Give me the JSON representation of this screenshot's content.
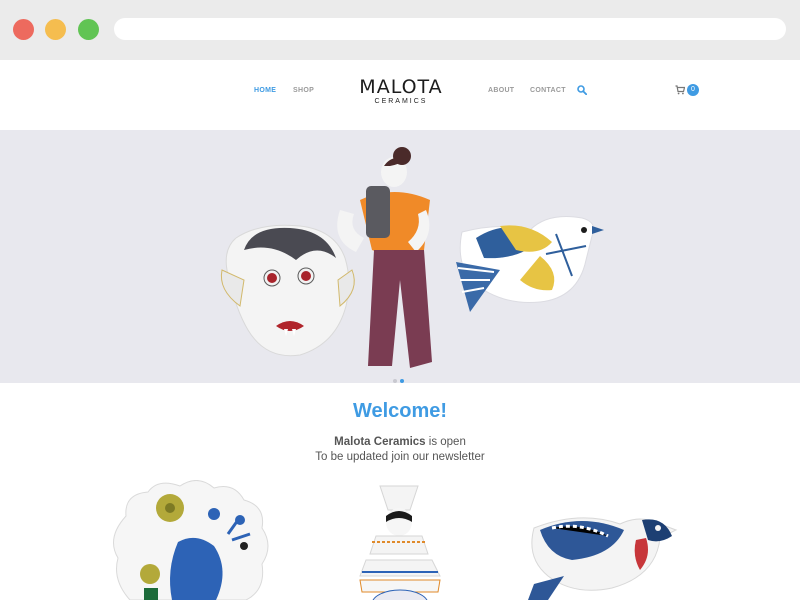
{
  "nav": {
    "home": "HOME",
    "shop": "SHOP",
    "about": "ABOUT",
    "contact": "CONTACT"
  },
  "logo": {
    "main": "MALOTA",
    "sub": "CERAMICS"
  },
  "cart": {
    "count": "0"
  },
  "icons": {
    "search": "search-icon",
    "cart": "cart-icon"
  },
  "hero": {
    "slides_total": 2,
    "active_slide": 2
  },
  "welcome": {
    "title": "Welcome!",
    "brand": "Malota Ceramics",
    "line1_rest": " is open",
    "line2": "To be updated join our newsletter"
  },
  "colors": {
    "accent": "#3f9be3",
    "hero_bg": "#e8e8ee"
  }
}
